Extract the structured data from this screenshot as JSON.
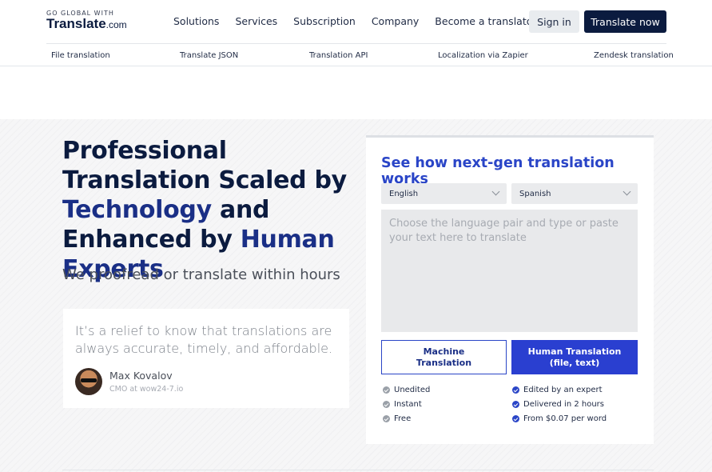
{
  "header": {
    "logo_top": "GO GLOBAL WITH",
    "logo_main": "Translate",
    "logo_domain": ".com",
    "nav": [
      "Solutions",
      "Services",
      "Subscription",
      "Company",
      "Become a translator"
    ],
    "sign_in": "Sign in",
    "translate_now": "Translate now"
  },
  "subnav": [
    "File translation",
    "Translate JSON",
    "Translation API",
    "Localization via Zapier",
    "Zendesk translation"
  ],
  "hero": {
    "headline_1": "Professional Translation Scaled by ",
    "headline_accent_1": "Technology",
    "headline_2": " and Enhanced by ",
    "headline_accent_2": "Human Experts",
    "subhead": "We proofread or translate within hours",
    "quote": "It’s a relief to know that translations are always accurate, timely, and affordable.",
    "author_name": "Max Kovalov",
    "author_role": "CMO at wow24-7.io"
  },
  "widget": {
    "title": "See how next-gen translation works",
    "source_lang": "English",
    "target_lang": "Spanish",
    "placeholder": "Choose the language pair and type or paste your text here to translate",
    "machine_label_1": "Machine",
    "machine_label_2": "Translation",
    "human_label_1": "Human Translation",
    "human_label_2": "(file, text)",
    "machine_features": [
      "Unedited",
      "Instant",
      "Free"
    ],
    "human_features": [
      "Edited by an expert",
      "Delivered in 2 hours",
      "From $0.07 per word"
    ]
  },
  "colors": {
    "navy": "#0b1b3f",
    "accent_blue": "#2a45c7",
    "button_blue": "#2a3fd0",
    "check_gray": "#9aa0a8"
  }
}
